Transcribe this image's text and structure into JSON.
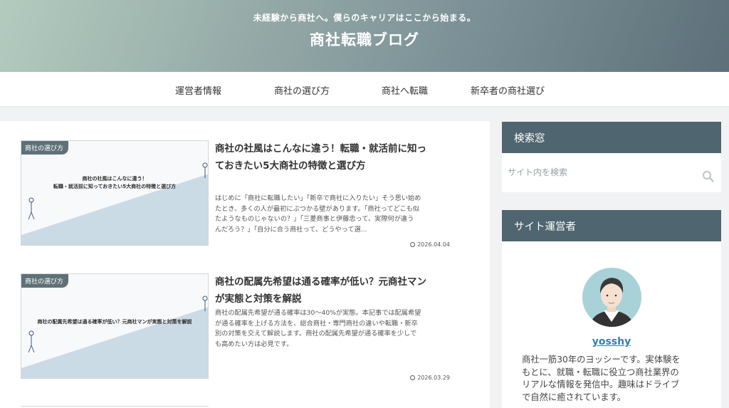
{
  "header": {
    "tagline": "未経験から商社へ。僕らのキャリアはここから始まる。",
    "site_title": "商社転職ブログ"
  },
  "nav": {
    "items": [
      "運営者情報",
      "商社の選び方",
      "商社へ転職",
      "新卒者の商社選び"
    ]
  },
  "posts": [
    {
      "category": "商社の選び方",
      "thumb_lines": [
        "商社の社風はこんなに違う！",
        "転職・就活前に知っておきたい5大商社の特徴と選び方"
      ],
      "title_lines": [
        "商社の社風はこんなに違う！転職・就活前に知っ",
        "ておきたい5大商社の特徴と選び方"
      ],
      "excerpt_lines": [
        "はじめに「商社に転職したい」「新卒で商社に入りたい」そう思い始め",
        "たとき、多くの人が最初にぶつかる壁があります。「商社ってどこも似",
        "たようなものじゃないの？」「三菱商事と伊藤忠って、実際何が違う",
        "んだろう？」「自分に合う商社って、どうやって選..."
      ],
      "date": "2026.04.04"
    },
    {
      "category": "商社の選び方",
      "thumb_lines": [
        "商社の配属先希望は通る確率が低い？元商社マンが実態と対策を解説"
      ],
      "title_lines": [
        "商社の配属先希望は通る確率が低い？元商社マン",
        "が実態と対策を解説"
      ],
      "excerpt_lines": [
        "商社の配属先希望が通る確率は30〜40%が実態。本記事では配属希望",
        "が通る確率を上げる方法を、総合商社・専門商社の違いや転職・新卒",
        "別の対策を交えて解説します。商社の配属先希望が通る確率を少しで",
        "も高めたい方は必見です。"
      ],
      "date": "2026.03.29"
    }
  ],
  "sidebar": {
    "search_title": "検索窓",
    "search_placeholder": "サイト内を検索",
    "profile_title": "サイト運営者",
    "profile_name": "yosshy",
    "profile_bio_lines": [
      "商社一筋30年のヨッシーです。実体験を",
      "もとに、就職・転職に役立つ商社業界の",
      "リアルな情報を発信中。趣味はドライブ",
      "で自然に癒されています。"
    ]
  },
  "colors": {
    "accent": "#4f656f",
    "badge": "#5f7178",
    "link": "#2f7fb5",
    "thumb_triangle": "#cbdbe6"
  },
  "icons": [
    "search-icon",
    "clock-icon",
    "avatar"
  ]
}
